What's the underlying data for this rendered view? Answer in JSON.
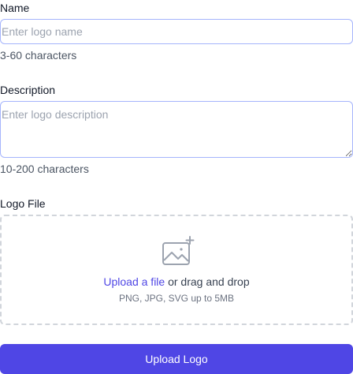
{
  "fields": {
    "name": {
      "label": "Name",
      "placeholder": "Enter logo name",
      "value": "",
      "hint": "3-60 characters"
    },
    "description": {
      "label": "Description",
      "placeholder": "Enter logo description",
      "value": "",
      "hint": "10-200 characters"
    },
    "logo_file": {
      "label": "Logo File",
      "upload_link": "Upload a file",
      "drag_text": " or drag and drop",
      "formats_hint": "PNG, JPG, SVG up to 5MB",
      "icon": "image-add-icon"
    }
  },
  "submit_label": "Upload Logo",
  "colors": {
    "accent": "#4f46e5",
    "input_border": "#a5b4fc",
    "dropzone_border": "#d1d5db"
  }
}
